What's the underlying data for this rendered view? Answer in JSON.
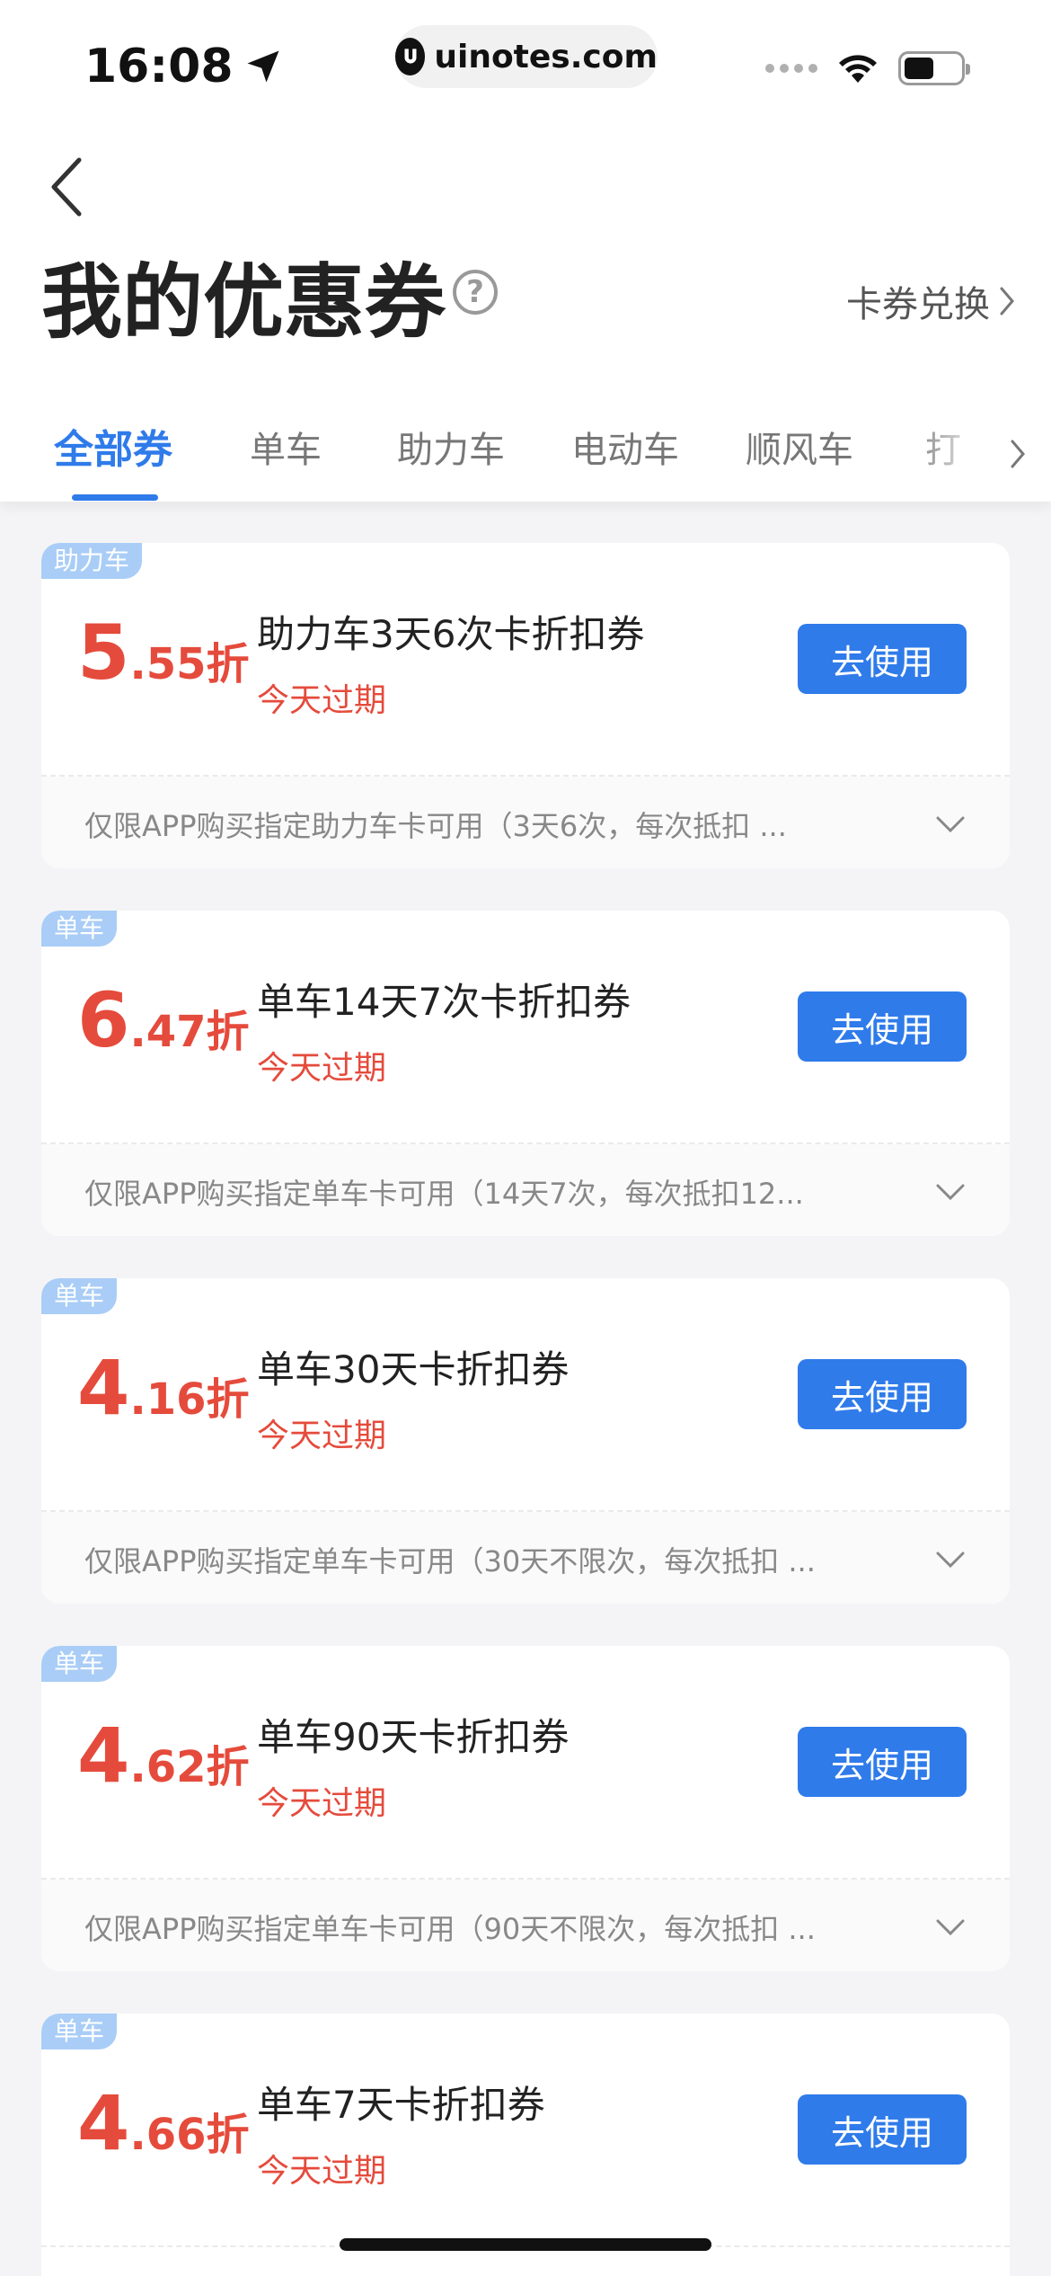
{
  "status_bar": {
    "time": "16:08",
    "url": "uinotes.com"
  },
  "header": {
    "title": "我的优惠券",
    "help_symbol": "?",
    "redeem_label": "卡券兑换"
  },
  "tabs": [
    {
      "label": "全部券",
      "active": true
    },
    {
      "label": "单车",
      "active": false
    },
    {
      "label": "助力车",
      "active": false
    },
    {
      "label": "电动车",
      "active": false
    },
    {
      "label": "顺风车",
      "active": false
    },
    {
      "label": "打",
      "active": false
    }
  ],
  "coupons": [
    {
      "tag": "助力车",
      "discount_int": "5",
      "discount_dec": ".55",
      "discount_unit": "折",
      "name": "助力车3天6次卡折扣券",
      "expiry": "今天过期",
      "button": "去使用",
      "description": "仅限APP购买指定助力车卡可用（3天6次，每次抵扣 ..."
    },
    {
      "tag": "单车",
      "discount_int": "6",
      "discount_dec": ".47",
      "discount_unit": "折",
      "name": "单车14天7次卡折扣券",
      "expiry": "今天过期",
      "button": "去使用",
      "description": "仅限APP购买指定单车卡可用（14天7次，每次抵扣12..."
    },
    {
      "tag": "单车",
      "discount_int": "4",
      "discount_dec": ".16",
      "discount_unit": "折",
      "name": "单车30天卡折扣券",
      "expiry": "今天过期",
      "button": "去使用",
      "description": "仅限APP购买指定单车卡可用（30天不限次，每次抵扣 ..."
    },
    {
      "tag": "单车",
      "discount_int": "4",
      "discount_dec": ".62",
      "discount_unit": "折",
      "name": "单车90天卡折扣券",
      "expiry": "今天过期",
      "button": "去使用",
      "description": "仅限APP购买指定单车卡可用（90天不限次，每次抵扣 ..."
    },
    {
      "tag": "单车",
      "discount_int": "4",
      "discount_dec": ".66",
      "discount_unit": "折",
      "name": "单车7天卡折扣券",
      "expiry": "今天过期",
      "button": "去使用",
      "description": ""
    }
  ],
  "colors": {
    "accent": "#2f7bea",
    "discount_red": "#e54b3c",
    "tag_blue": "#a9cdf6"
  }
}
